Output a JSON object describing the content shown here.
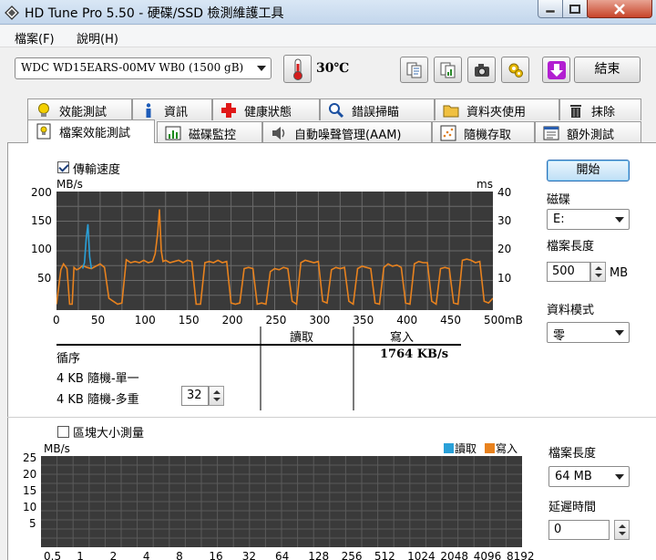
{
  "window": {
    "title": "HD Tune Pro 5.50 - 硬碟/SSD 檢測維護工具"
  },
  "menu": {
    "file": "檔案(F)",
    "help": "說明(H)"
  },
  "toolbar": {
    "drive": "WDC WD15EARS-00MV WB0 (1500 gB)",
    "temperature": "30℃",
    "exit_label": "結束"
  },
  "tabs_top": [
    {
      "label": "效能測試",
      "icon": "bulb-icon"
    },
    {
      "label": "資訊",
      "icon": "info-icon"
    },
    {
      "label": "健康狀態",
      "icon": "health-cross-icon"
    },
    {
      "label": "錯誤掃瞄",
      "icon": "magnifier-icon"
    },
    {
      "label": "資料夾使用",
      "icon": "folder-icon"
    },
    {
      "label": "抹除",
      "icon": "trash-icon"
    }
  ],
  "tabs_bottom": [
    {
      "label": "檔案效能測試",
      "icon": "file-bench-icon",
      "active": true
    },
    {
      "label": "磁碟監控",
      "icon": "monitor-chart-icon"
    },
    {
      "label": "自動噪聲管理(AAM)",
      "icon": "speaker-icon"
    },
    {
      "label": "隨機存取",
      "icon": "scatter-icon"
    },
    {
      "label": "額外測試",
      "icon": "extra-tests-icon"
    }
  ],
  "file_bench": {
    "transfer_checkbox": "傳輸速度",
    "transfer_checked": true,
    "start_label": "開始",
    "disk_label": "磁碟",
    "disk_value": "E:",
    "file_length_label": "檔案長度",
    "file_length_value": "500",
    "file_length_unit": "MB",
    "data_mode_label": "資料模式",
    "data_mode_value": "零",
    "read_header": "讀取",
    "write_header": "寫入",
    "sequential_label": "循序",
    "sequential_write": "1764 KB/s",
    "random_single_label": "4 KB 隨機-單一",
    "random_multi_label": "4 KB 隨機-多重",
    "queue_depth": "32"
  },
  "block_bench": {
    "checkbox_label": "區塊大小測量",
    "checked": false,
    "legend_read": "讀取",
    "legend_write": "寫入",
    "file_length_label": "檔案長度",
    "file_length_value": "64 MB",
    "delay_label": "延遲時間",
    "delay_value": "0"
  },
  "colors": {
    "read": "#2aa0d8",
    "write": "#e8821e",
    "chart_bg": "#3a3a3a",
    "grid": "#6a6a6a"
  },
  "chart_data": [
    {
      "type": "line",
      "xlabel": "mB",
      "ylabel": "MB/s",
      "y2label": "ms",
      "x_ticks": [
        "0",
        "50",
        "100",
        "150",
        "200",
        "250",
        "300",
        "350",
        "400",
        "450",
        "500mB"
      ],
      "y_ticks": [
        "200",
        "150",
        "100",
        "50"
      ],
      "y2_ticks": [
        "40",
        "30",
        "20",
        "10"
      ],
      "xlim": [
        0,
        500
      ],
      "ylim": [
        0,
        200
      ],
      "series": [
        {
          "name": "寫入",
          "x": [
            0,
            5,
            8,
            12,
            15,
            18,
            20,
            23,
            26,
            30,
            35,
            40,
            45,
            50,
            55,
            60,
            65,
            70,
            75,
            80,
            85,
            90,
            95,
            100,
            105,
            110,
            113,
            116,
            118,
            120,
            122,
            125,
            130,
            135,
            140,
            145,
            150,
            155,
            160,
            165,
            170,
            175,
            180,
            185,
            190,
            195,
            200,
            205,
            210,
            215,
            220,
            225,
            230,
            235,
            240,
            245,
            250,
            255,
            260,
            265,
            270,
            275,
            280,
            285,
            290,
            295,
            300,
            305,
            310,
            315,
            320,
            325,
            330,
            335,
            340,
            345,
            350,
            355,
            360,
            365,
            370,
            375,
            380,
            385,
            390,
            395,
            400,
            405,
            410,
            415,
            420,
            425,
            430,
            435,
            440,
            445,
            450,
            455,
            460,
            465,
            470,
            475,
            480,
            485,
            490,
            495,
            500
          ],
          "values": [
            10,
            68,
            78,
            70,
            10,
            10,
            72,
            68,
            70,
            75,
            72,
            70,
            74,
            78,
            72,
            20,
            15,
            10,
            12,
            85,
            80,
            82,
            80,
            84,
            80,
            82,
            95,
            130,
            170,
            100,
            82,
            84,
            80,
            82,
            84,
            80,
            84,
            82,
            10,
            10,
            80,
            82,
            80,
            84,
            80,
            82,
            12,
            10,
            12,
            70,
            72,
            70,
            10,
            12,
            10,
            65,
            70,
            68,
            72,
            70,
            15,
            10,
            80,
            84,
            82,
            80,
            82,
            15,
            12,
            68,
            72,
            70,
            72,
            15,
            10,
            70,
            74,
            72,
            70,
            12,
            10,
            72,
            78,
            74,
            76,
            72,
            12,
            10,
            78,
            82,
            80,
            80,
            15,
            10,
            70,
            72,
            70,
            12,
            10,
            84,
            86,
            84,
            80,
            82,
            15,
            12,
            20
          ]
        },
        {
          "name": "讀取",
          "x": [
            30,
            32,
            34,
            36,
            38,
            40
          ],
          "values": [
            70,
            80,
            120,
            145,
            90,
            70
          ]
        }
      ]
    },
    {
      "type": "bar",
      "ylabel": "MB/s",
      "y_ticks": [
        "25",
        "20",
        "15",
        "10",
        "5"
      ],
      "ylim": [
        0,
        25
      ],
      "x_ticks": [
        "0.5",
        "1",
        "2",
        "4",
        "8",
        "16",
        "32",
        "64",
        "128",
        "256",
        "512",
        "1024",
        "2048",
        "4096",
        "8192"
      ],
      "series": [
        {
          "name": "讀取",
          "values": []
        },
        {
          "name": "寫入",
          "values": []
        }
      ]
    }
  ]
}
